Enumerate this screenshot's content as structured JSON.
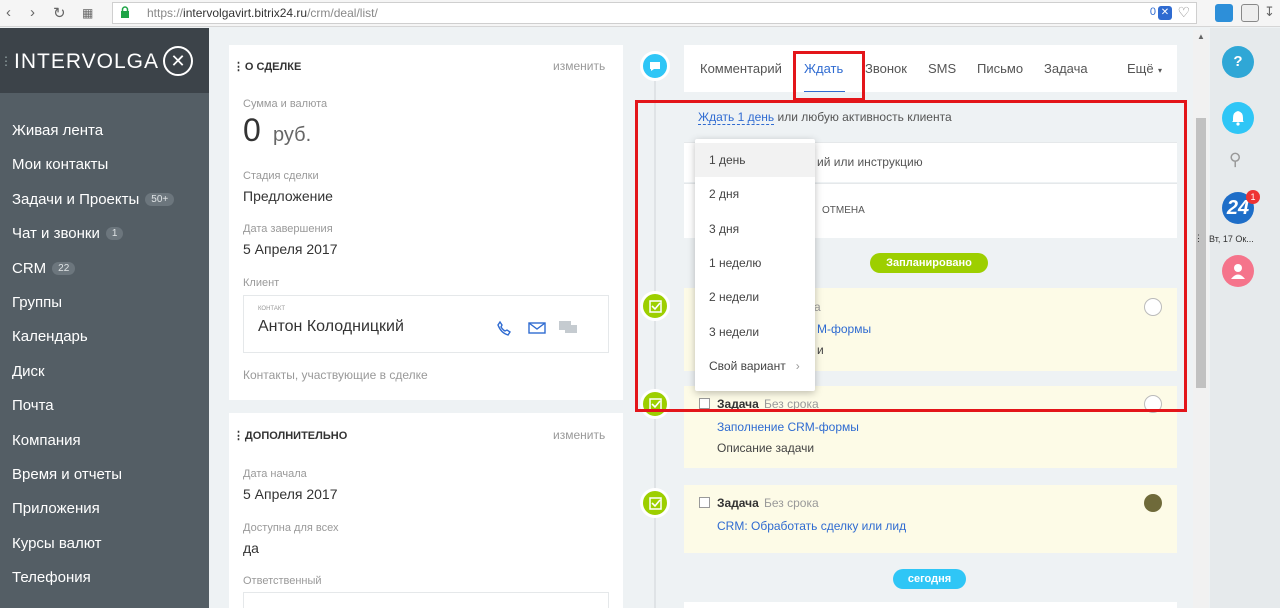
{
  "browser": {
    "url_prefix": "https://",
    "url_host": "intervolgavirt.bitrix24.ru",
    "url_path": "/crm/deal/list/",
    "badge_count": "0"
  },
  "logo": {
    "text": "INTERVOLGA"
  },
  "menu": [
    {
      "label": "Живая лента"
    },
    {
      "label": "Мои контакты"
    },
    {
      "label": "Задачи и Проекты",
      "badge": "50+"
    },
    {
      "label": "Чат и звонки",
      "badge": "1"
    },
    {
      "label": "CRM",
      "badge": "22"
    },
    {
      "label": "Группы"
    },
    {
      "label": "Календарь"
    },
    {
      "label": "Диск"
    },
    {
      "label": "Почта"
    },
    {
      "label": "Компания"
    },
    {
      "label": "Время и отчеты"
    },
    {
      "label": "Приложения"
    },
    {
      "label": "Курсы валют"
    },
    {
      "label": "Телефония"
    }
  ],
  "about": {
    "title": "О СДЕЛКЕ",
    "edit": "изменить",
    "sum_label": "Сумма и валюта",
    "sum_value": "0",
    "sum_currency": "руб.",
    "stage_label": "Стадия сделки",
    "stage_value": "Предложение",
    "end_label": "Дата завершения",
    "end_value": "5 Апреля 2017",
    "client_label": "Клиент",
    "contact_tag": "КОНТАКТ",
    "contact_name": "Антон Колодницкий",
    "contacts_note": "Контакты, участвующие в сделке"
  },
  "extra": {
    "title": "ДОПОЛНИТЕЛЬНО",
    "edit": "изменить",
    "start_label": "Дата начала",
    "start_value": "5 Апреля 2017",
    "public_label": "Доступна для всех",
    "public_value": "да",
    "resp_label": "Ответственный"
  },
  "tabs": [
    "Комментарий",
    "Ждать",
    "Звонок",
    "SMS",
    "Письмо",
    "Задача",
    "Ещё"
  ],
  "wait": {
    "link": "Ждать 1 день",
    "rest": "или любую активность клиента",
    "comment_tail": "ий или инструкцию",
    "cancel": "ОТМЕНА"
  },
  "dropdown": [
    "1 день",
    "2 дня",
    "3 дня",
    "1 неделю",
    "2 недели",
    "3 недели",
    "Свой вариант"
  ],
  "planned_label": "Запланировано",
  "today_label": "сегодня",
  "tasks": [
    {
      "title_tail": "а",
      "link_tail": "М-формы",
      "desc_tail": "и"
    },
    {
      "title": "Задача",
      "sub": "Без срока",
      "link": "Заполнение CRM-формы",
      "desc": "Описание задачи"
    },
    {
      "title": "Задача",
      "sub": "Без срока",
      "link": "CRM: Обработать сделку или лид"
    }
  ],
  "right": {
    "help": "?",
    "b24": "24",
    "b24_badge": "1",
    "date": "Вт, 17 Ок..."
  },
  "colors": {
    "accent": "#2f6bd1",
    "green": "#9dcf00",
    "cyan": "#2fc6f6",
    "red_box": "#e3151a"
  }
}
